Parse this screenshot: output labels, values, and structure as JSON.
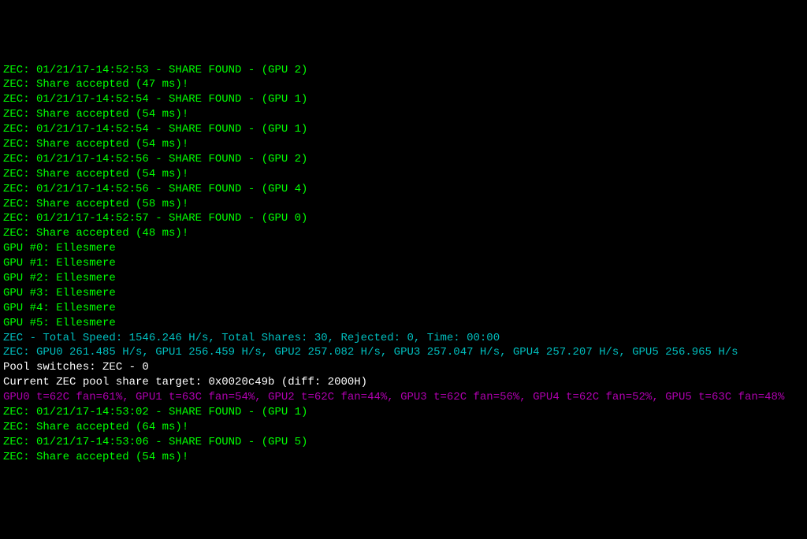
{
  "shares_top": [
    {
      "time": "01/21/17-14:52:53",
      "gpu": 2,
      "ms": 47
    },
    {
      "time": "01/21/17-14:52:54",
      "gpu": 1,
      "ms": 54
    },
    {
      "time": "01/21/17-14:52:54",
      "gpu": 1,
      "ms": 54
    },
    {
      "time": "01/21/17-14:52:56",
      "gpu": 2,
      "ms": 54
    },
    {
      "time": "01/21/17-14:52:56",
      "gpu": 4,
      "ms": 58
    },
    {
      "time": "01/21/17-14:52:57",
      "gpu": 0,
      "ms": 48
    }
  ],
  "gpus": [
    {
      "id": 0,
      "name": "Ellesmere"
    },
    {
      "id": 1,
      "name": "Ellesmere"
    },
    {
      "id": 2,
      "name": "Ellesmere"
    },
    {
      "id": 3,
      "name": "Ellesmere"
    },
    {
      "id": 4,
      "name": "Ellesmere"
    },
    {
      "id": 5,
      "name": "Ellesmere"
    }
  ],
  "totals": {
    "speed": "1546.246 H/s",
    "shares": 30,
    "rejected": 0,
    "time": "00:00"
  },
  "hashrates": [
    {
      "gpu": 0,
      "rate": "261.485 H/s"
    },
    {
      "gpu": 1,
      "rate": "256.459 H/s"
    },
    {
      "gpu": 2,
      "rate": "257.082 H/s"
    },
    {
      "gpu": 3,
      "rate": "257.047 H/s"
    },
    {
      "gpu": 4,
      "rate": "257.207 H/s"
    },
    {
      "gpu": 5,
      "rate": "256.965 H/s"
    }
  ],
  "pool": {
    "switches": "ZEC - 0",
    "target_line": "Current ZEC pool share target: 0x0020c49b (diff: 2000H)"
  },
  "temps": [
    {
      "gpu": 0,
      "t": "62C",
      "fan": "61%"
    },
    {
      "gpu": 1,
      "t": "63C",
      "fan": "54%"
    },
    {
      "gpu": 2,
      "t": "62C",
      "fan": "44%"
    },
    {
      "gpu": 3,
      "t": "62C",
      "fan": "56%"
    },
    {
      "gpu": 4,
      "t": "62C",
      "fan": "52%"
    },
    {
      "gpu": 5,
      "t": "63C",
      "fan": "48%"
    }
  ],
  "shares_bottom": [
    {
      "time": "01/21/17-14:53:02",
      "gpu": 1,
      "ms": 64
    },
    {
      "time": "01/21/17-14:53:06",
      "gpu": 5,
      "ms": 54
    }
  ]
}
